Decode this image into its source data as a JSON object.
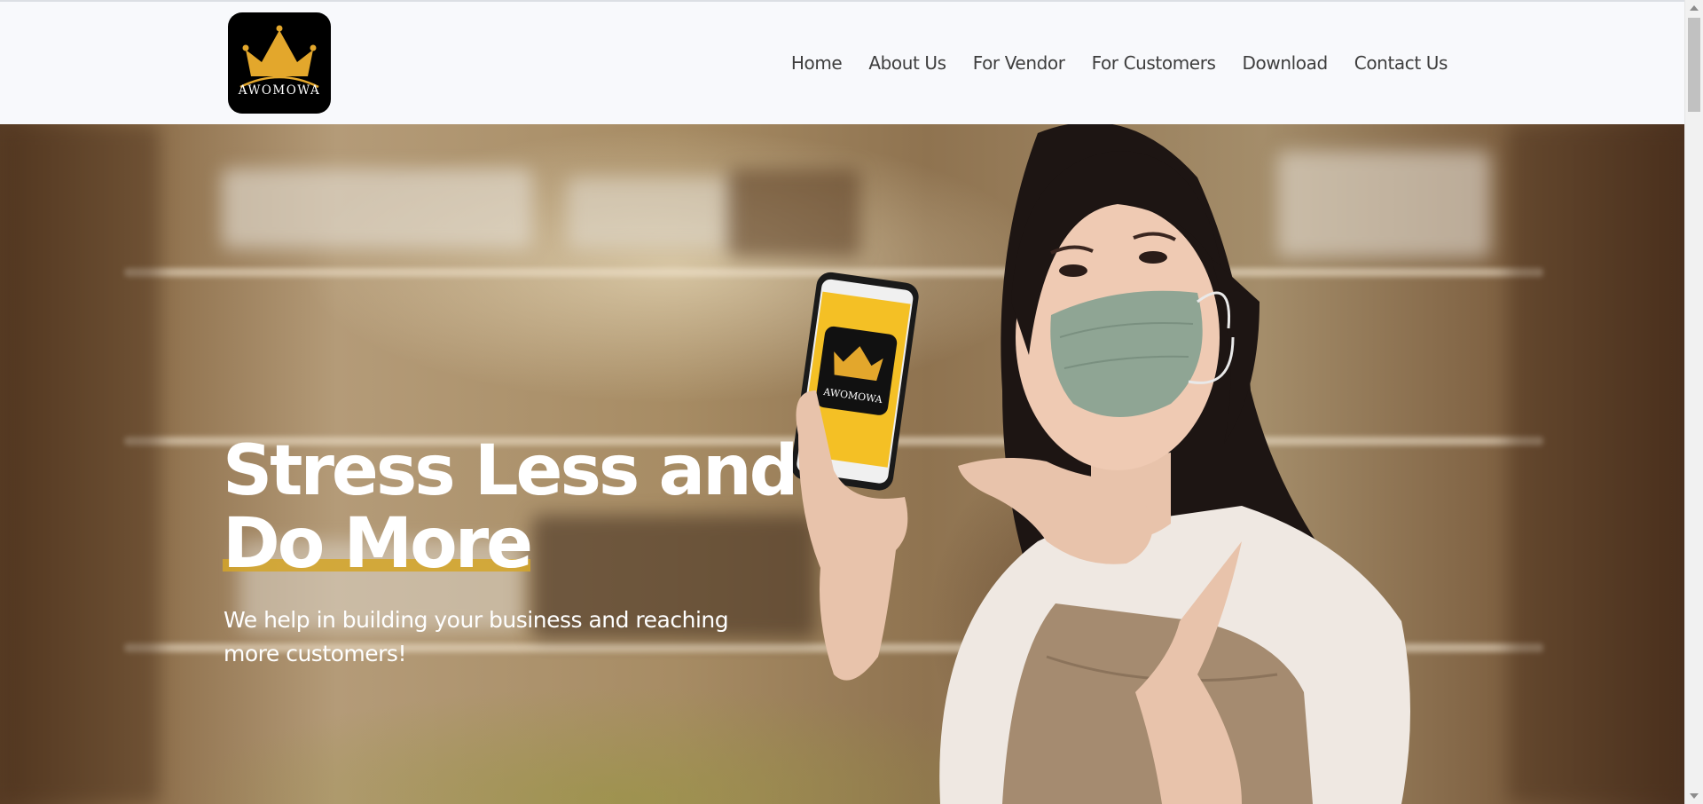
{
  "brand": {
    "logo_text": "AWOMOWA",
    "accent_color": "#e3a72c"
  },
  "nav": {
    "items": [
      {
        "label": "Home"
      },
      {
        "label": "About Us"
      },
      {
        "label": "For Vendor"
      },
      {
        "label": "For Customers"
      },
      {
        "label": "Download"
      },
      {
        "label": "Contact Us"
      }
    ]
  },
  "hero": {
    "title_line1": "Stress Less and",
    "title_line2": "Do More",
    "subtitle": "We help in building your business and reaching more customers!",
    "phone_logo_text": "AWOMOWA"
  },
  "colors": {
    "header_bg": "#f8f9fc",
    "nav_text": "#3e3e3e",
    "highlight": "#d4a528"
  },
  "icons": [
    "crown-icon",
    "scroll-up-icon",
    "scroll-down-icon"
  ]
}
